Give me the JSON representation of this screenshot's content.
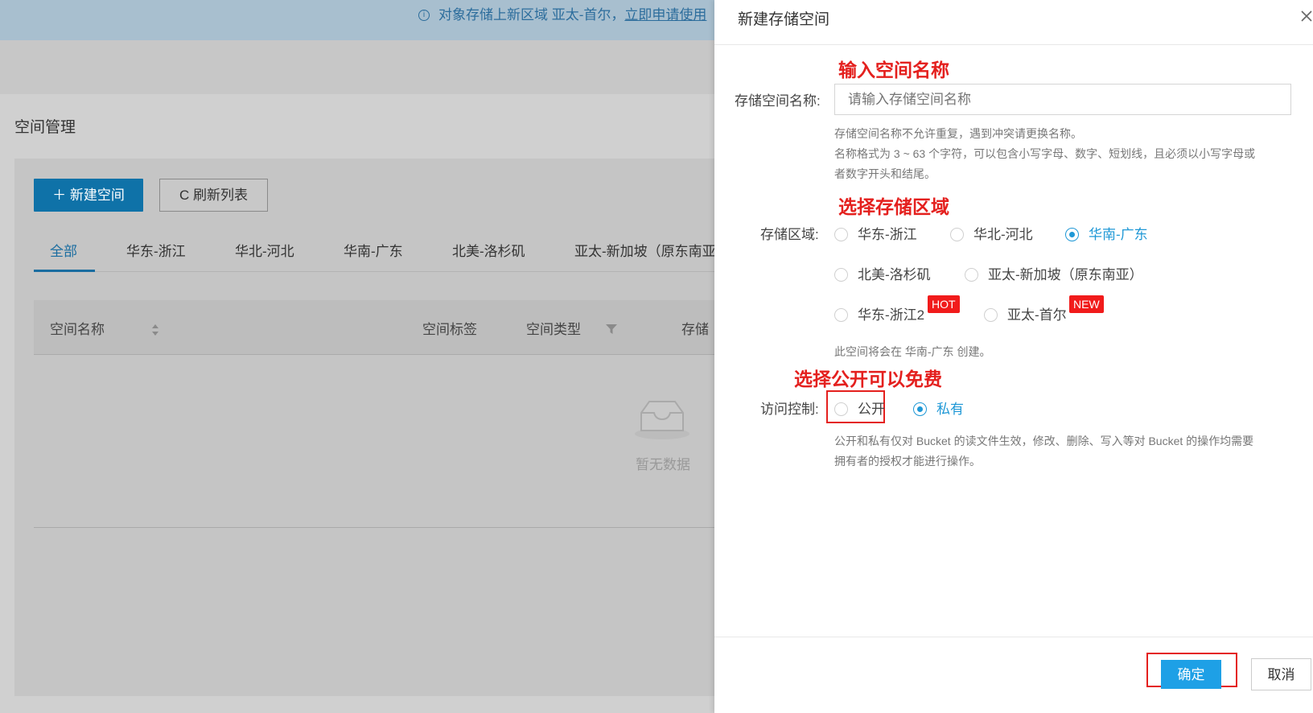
{
  "notice": {
    "text": "对象存储上新区域 亚太-首尔，",
    "link": "立即申请使用"
  },
  "page": {
    "title": "空间管理"
  },
  "toolbar": {
    "create_label": "＋ 新建空间",
    "refresh_label": "刷新列表"
  },
  "tabs": [
    "全部",
    "华东-浙江",
    "华北-河北",
    "华南-广东",
    "北美-洛杉矶",
    "亚太-新加坡（原东南亚"
  ],
  "table": {
    "headers": [
      "空间名称",
      "空间标签",
      "空间类型",
      "存储"
    ],
    "empty_text": "暂无数据"
  },
  "drawer": {
    "title": "新建存储空间",
    "close": "X",
    "annotations": {
      "name": "输入空间名称",
      "region": "选择存储区域",
      "access": "选择公开可以免费"
    },
    "name_label": "存储空间名称:",
    "name_placeholder": "请输入存储空间名称",
    "name_help": [
      "存储空间名称不允许重复，遇到冲突请更换名称。",
      "名称格式为 3 ~ 63 个字符，可以包含小写字母、数字、短划线，且必须以小写字母或",
      "者数字开头和结尾。"
    ],
    "region_label": "存储区域:",
    "regions": [
      "华东-浙江",
      "华北-河北",
      "华南-广东",
      "北美-洛杉矶",
      "亚太-新加坡（原东南亚）",
      "华东-浙江2",
      "亚太-首尔"
    ],
    "selected_region": "华南-广东",
    "badges": {
      "hot": "HOT",
      "new": "NEW"
    },
    "region_help": "此空间将会在 华南-广东 创建。",
    "access_label": "访问控制:",
    "access_options": [
      "公开",
      "私有"
    ],
    "selected_access": "私有",
    "access_help": [
      "公开和私有仅对 Bucket 的读文件生效，修改、删除、写入等对 Bucket 的操作均需要",
      "拥有者的授权才能进行操作。"
    ],
    "ok_label": "确定",
    "cancel_label": "取消"
  }
}
